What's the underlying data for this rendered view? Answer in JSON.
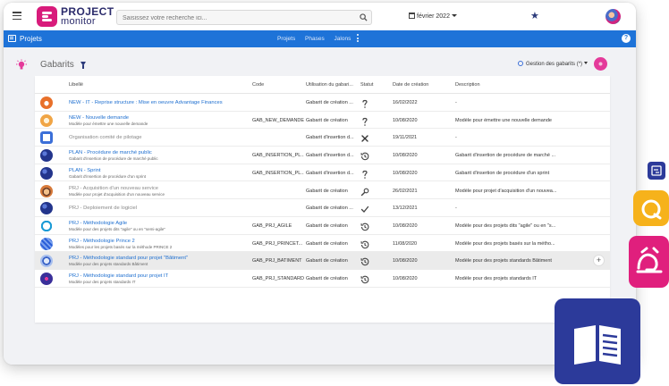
{
  "app": {
    "logo_line1": "PROJECT",
    "logo_line2": "monitor",
    "search_placeholder": "Saisissez votre recherche ici...",
    "date": "février 2022"
  },
  "navbar": {
    "title": "Projets",
    "links": [
      "Projets",
      "Phases",
      "Jalons"
    ]
  },
  "page": {
    "title": "Gabarits",
    "gestion_label": "Gestion des gabarits (*)"
  },
  "table": {
    "headers": {
      "libelle": "Libellé",
      "code": "Code",
      "utilisation": "Utilisation du gabari...",
      "statut": "Statut",
      "date": "Date de création",
      "description": "Description"
    },
    "rows": [
      {
        "title": "NEW - IT - Reprise structure : Mise en oeuvre Advantage Finances",
        "subtitle": "",
        "code": "",
        "usage": "Gabarit de création ...",
        "status_icon": "question-icon",
        "date": "16/02/2022",
        "description": "-",
        "avatar": "orange"
      },
      {
        "title": "NEW - Nouvelle demande",
        "subtitle": "Modèle pour émettre une nouvelle demande",
        "code": "GAB_NEW_DEMANDE",
        "usage": "Gabarit de création",
        "status_icon": "question-icon",
        "date": "10/08/2020",
        "description": "Modèle pour émettre une nouvelle demande",
        "avatar": "lightorange"
      },
      {
        "title": "Organisation comité de pilotage",
        "subtitle": "",
        "code": "",
        "usage": "Gabarit d'insertion d...",
        "status_icon": "close-icon",
        "date": "19/11/2021",
        "description": "-",
        "avatar": "blue-square",
        "grey": true
      },
      {
        "title": "PLAN - Procédure de marché public",
        "subtitle": "Gabarit d'insertion de procédure de marché public",
        "code": "GAB_INSERTION_PL...",
        "usage": "Gabarit d'insertion d...",
        "status_icon": "history-icon",
        "date": "10/08/2020",
        "description": "Gabarit d'insertion de procédure de marché ...",
        "avatar": "navy"
      },
      {
        "title": "PLAN - Sprint",
        "subtitle": "Gabarit d'insertion de procédure d'un sprint",
        "code": "GAB_INSERTION_PL...",
        "usage": "Gabarit d'insertion d...",
        "status_icon": "question-icon",
        "date": "10/08/2020",
        "description": "Gabarit d'insertion de procédure d'un sprint",
        "avatar": "navy"
      },
      {
        "title": "PRJ - Acquisition d'un nouveau service",
        "subtitle": "Modèle pour projet d'acquisition d'un nouveau service",
        "code": "",
        "usage": "Gabarit de création",
        "status_icon": "wrench-icon",
        "date": "26/02/2021",
        "description": "Modèle pour projet d'acquisition d'un nouvea...",
        "avatar": "plate",
        "grey": true
      },
      {
        "title": "PRJ - Deploiement de logiciel",
        "subtitle": "",
        "code": "",
        "usage": "Gabarit de création ...",
        "status_icon": "check-icon",
        "date": "13/12/2021",
        "description": "-",
        "avatar": "navy",
        "grey": true
      },
      {
        "title": "PRJ - Méthodologie Agile",
        "subtitle": "Modèle pour des projets dits \"agile\" ou en \"semi-agile\"",
        "code": "GAB_PRJ_AGILE",
        "usage": "Gabarit de création",
        "status_icon": "history-icon",
        "date": "10/08/2020",
        "description": "Modèle pour des projets dits \"agile\" ou en \"s...",
        "avatar": "ring"
      },
      {
        "title": "PRJ - Méthodologie Prince 2",
        "subtitle": "Modèles pour les projets basés sur la méthode PRINCE 2",
        "code": "GAB_PRJ_PRINCET...",
        "usage": "Gabarit de création",
        "status_icon": "history-icon",
        "date": "11/08/2020",
        "description": "Modèle pour des projets basés sur la métho...",
        "avatar": "blue-grid"
      },
      {
        "title": "PRJ - Méthodologie standard pour projet \"Bâtiment\"",
        "subtitle": "Modèle pour des projets standards Bâtiment",
        "code": "GAB_PRJ_BATIMENT",
        "usage": "Gabarit de création",
        "status_icon": "history-icon",
        "date": "10/08/2020",
        "description": "Modèle pour des projets standards Bâtiment",
        "avatar": "globe",
        "highlight": true
      },
      {
        "title": "PRJ - Méthodologie standard pour projet IT",
        "subtitle": "Modèle pour des projets standards IT",
        "code": "GAB_PRJ_STANDARD",
        "usage": "Gabarit de création",
        "status_icon": "history-icon",
        "date": "10/08/2020",
        "description": "Modèle pour des projets standards IT",
        "avatar": "purple"
      }
    ],
    "row_action": "+"
  },
  "colors": {
    "brand": "#d81b7b",
    "navbar": "#1e73d8",
    "link": "#1e6fd0",
    "navy": "#2c3a9a",
    "yellow": "#f6b21b",
    "pink": "#e01f7d"
  }
}
